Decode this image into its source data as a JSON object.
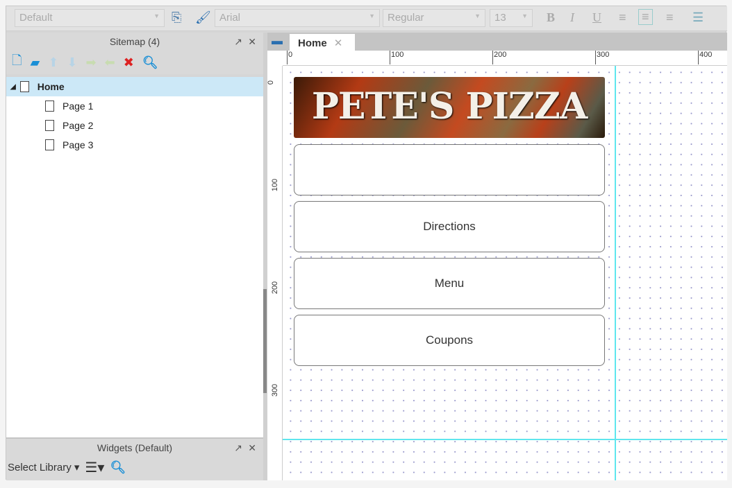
{
  "toolbar": {
    "style": "Default",
    "font": "Arial",
    "weight": "Regular",
    "size": "13",
    "bold": "B",
    "italic": "I",
    "underline": "U"
  },
  "sitemap": {
    "title": "Sitemap (4)",
    "pages": [
      {
        "label": "Home"
      },
      {
        "label": "Page 1"
      },
      {
        "label": "Page 2"
      },
      {
        "label": "Page 3"
      }
    ]
  },
  "widgets": {
    "title": "Widgets (Default)",
    "select_library": "Select Library"
  },
  "canvas": {
    "tab": "Home",
    "ruler_top": [
      "0",
      "100",
      "200",
      "300",
      "400"
    ],
    "ruler_left": [
      "0",
      "100",
      "200",
      "300"
    ],
    "header_text": "PETE'S PIZZA",
    "buttons": [
      "",
      "Directions",
      "Menu",
      "Coupons"
    ]
  },
  "colors": {
    "guide": "#5ee6ee",
    "selection": "#cce8f7",
    "accent": "#1a8fd6"
  }
}
